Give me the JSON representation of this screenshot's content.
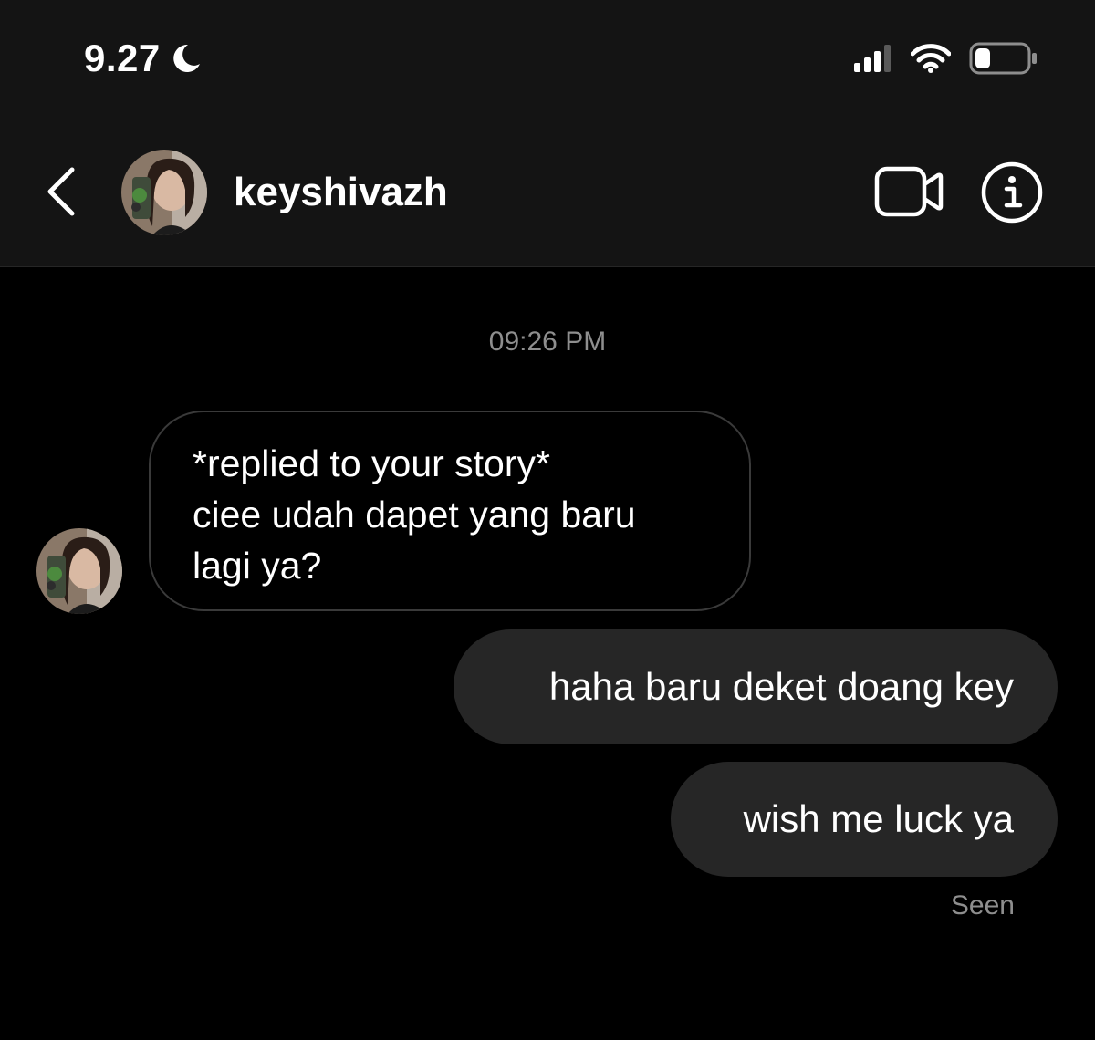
{
  "status_bar": {
    "time": "9.27",
    "icons": [
      "moon-icon",
      "signal-icon",
      "wifi-icon",
      "battery-icon"
    ],
    "battery_level": 0.3
  },
  "header": {
    "back_icon": "chevron-left-icon",
    "username": "keyshivazh",
    "actions": [
      "video-call-icon",
      "info-icon"
    ]
  },
  "conversation": {
    "timestamp": "09:26 PM",
    "incoming": {
      "lines": [
        "*replied to your story*",
        "ciee udah dapet yang baru",
        "lagi ya?"
      ]
    },
    "outgoing": [
      {
        "text": "haha baru deket doang key"
      },
      {
        "text": "wish me luck ya"
      }
    ],
    "read_receipt": "Seen"
  },
  "colors": {
    "background": "#000000",
    "header_background": "#141414",
    "outgoing_bubble": "#262626",
    "incoming_border": "#3a3a3a",
    "muted_text": "#8e8e8e"
  }
}
